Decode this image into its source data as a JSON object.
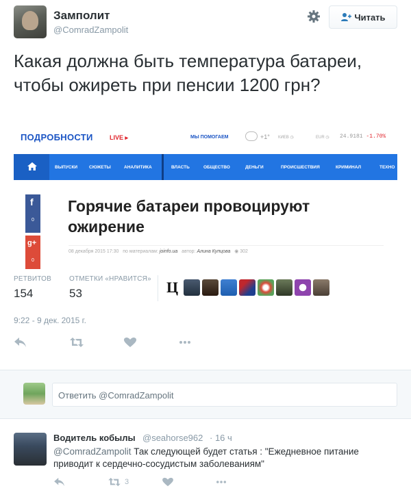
{
  "tweet": {
    "author_name": "Замполит",
    "author_handle": "@ComradZampolit",
    "follow_label": "Читать",
    "text": "Какая должна быть температура батареи, чтобы ожиреть при пенсии 1200 грн?",
    "stats": {
      "retweets_label": "РЕТВИТОВ",
      "retweets_value": "154",
      "likes_label": "ОТМЕТКИ «НРАВИТСЯ»",
      "likes_value": "53"
    },
    "fav_first_letter": "Ц",
    "timestamp": "9:22 - 9 дек. 2015 г.",
    "icons": [
      "gear-icon",
      "follow-person-plus-icon",
      "reply-icon",
      "retweet-icon",
      "like-icon",
      "more-icon"
    ]
  },
  "media": {
    "site_logo": "ПОДРОБНОСТИ",
    "live_label": "LIVE ▸",
    "help_label": "МЫ ПОМОГАЕМ",
    "temperature": "+1°",
    "city": "КИЕВ ◷",
    "currency": "EUR ◷",
    "rate": "24.9181",
    "rate_change": "-1.70%",
    "nav": [
      "ВЫПУСКИ",
      "СЮЖЕТЫ",
      "АНАЛИТИКА",
      "ВЛАСТЬ",
      "ОБЩЕСТВО",
      "ДЕНЬГИ",
      "ПРОИСШЕСТВИЯ",
      "КРИМИНАЛ",
      "ТЕХНО"
    ],
    "fb_glyph": "f",
    "fb_count": "0",
    "gplus_glyph": "g+",
    "gplus_count": "0",
    "headline": "Горячие батареи провоцируют ожирение",
    "meta_date": "08 декабря 2015 17:30",
    "meta_by_label": "по материалам:",
    "meta_source": "joinfo.ua",
    "meta_author_label": "автор:",
    "meta_author": "Алина Купцова",
    "meta_views": "302"
  },
  "reply_box": {
    "placeholder": "Ответить @ComradZampolit"
  },
  "reply_tweet": {
    "author_name": "Водитель кобылы",
    "author_handle": "@seahorse962",
    "time": "· 16 ч",
    "mention": "@ComradZampolit",
    "text": " Так следующей будет статья : \"Ежедневное питание приводит к сердечно-сосудистым заболеваниям\"",
    "retweet_count": "3"
  },
  "colors": {
    "link_blue": "#2275e2",
    "facebook": "#3b5998",
    "google_plus": "#dd4b39",
    "muted_text": "#8899a6"
  }
}
